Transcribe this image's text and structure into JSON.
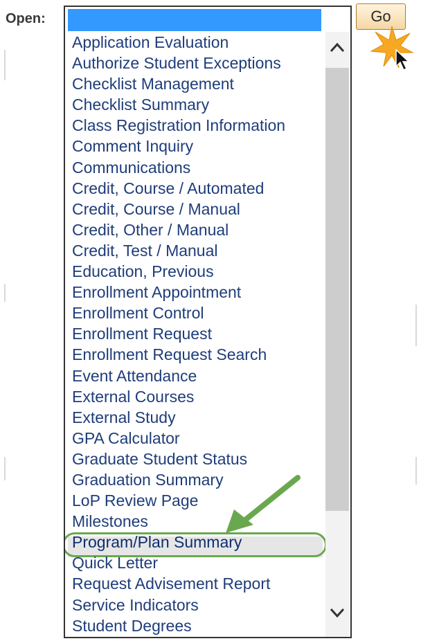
{
  "label": "Open:",
  "go_button": "Go",
  "dropdown": {
    "selected_value": "",
    "options": [
      "Application Evaluation",
      "Authorize Student Exceptions",
      "Checklist Management",
      "Checklist Summary",
      "Class Registration Information",
      "Comment Inquiry",
      "Communications",
      "Credit, Course / Automated",
      "Credit, Course / Manual",
      "Credit, Other / Manual",
      "Credit, Test / Manual",
      "Education, Previous",
      "Enrollment Appointment",
      "Enrollment Control",
      "Enrollment Request",
      "Enrollment Request Search",
      "Event Attendance",
      "External Courses",
      "External Study",
      "GPA Calculator",
      "Graduate Student Status",
      "Graduation Summary",
      "LoP Review Page",
      "Milestones",
      "Program/Plan Summary",
      "Quick Letter",
      "Request Advisement Report",
      "Service Indicators",
      "Student Degrees"
    ],
    "highlighted_option": "Program/Plan Summary"
  },
  "colors": {
    "selection": "#3399ff",
    "annotation_green": "#6aa84f",
    "star": "#f7a823"
  },
  "icons": {
    "scroll_up": "chevron-up-icon",
    "scroll_down": "chevron-down-icon",
    "pointer": "mouse-cursor-icon",
    "callout": "star-burst-icon",
    "annotation": "green-arrow-icon"
  }
}
